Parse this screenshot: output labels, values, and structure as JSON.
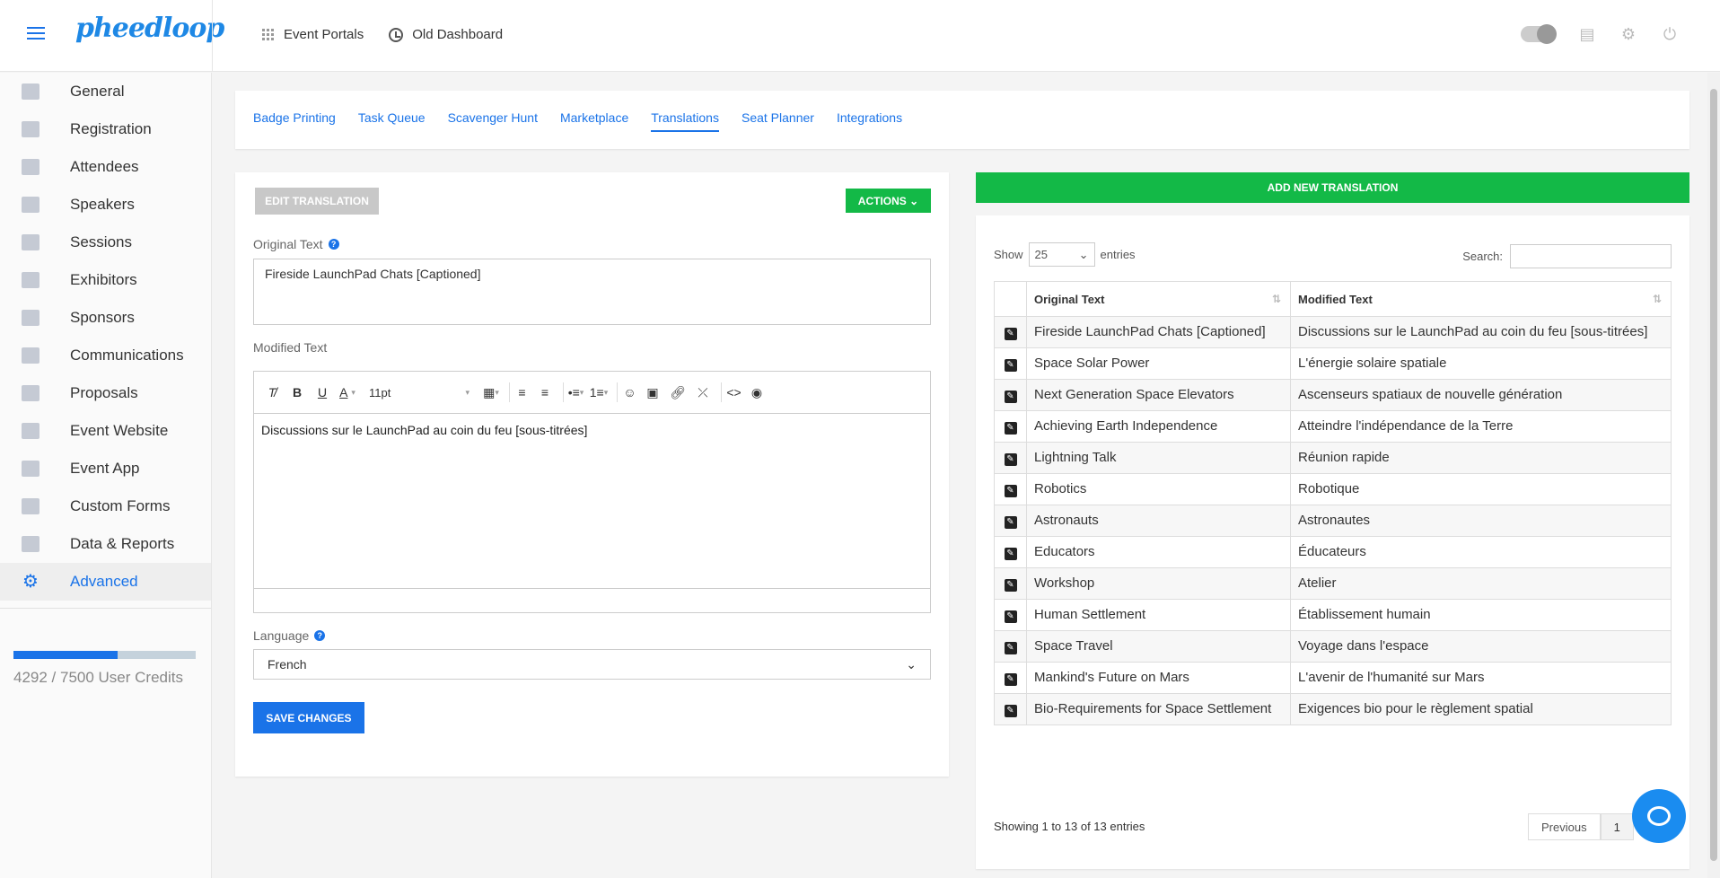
{
  "app": {
    "logo": "pheedloop"
  },
  "topnav": {
    "event_portals": "Event Portals",
    "old_dashboard": "Old Dashboard"
  },
  "sidebar": {
    "items": [
      {
        "label": "General",
        "icon": "pencil-icon"
      },
      {
        "label": "Registration",
        "icon": "users-icon"
      },
      {
        "label": "Attendees",
        "icon": "badge-icon"
      },
      {
        "label": "Speakers",
        "icon": "speaker-icon"
      },
      {
        "label": "Sessions",
        "icon": "upload-icon"
      },
      {
        "label": "Exhibitors",
        "icon": "store-icon"
      },
      {
        "label": "Sponsors",
        "icon": "briefcase-icon"
      },
      {
        "label": "Communications",
        "icon": "chat-icon"
      },
      {
        "label": "Proposals",
        "icon": "document-icon"
      },
      {
        "label": "Event Website",
        "icon": "browser-icon"
      },
      {
        "label": "Event App",
        "icon": "phone-icon"
      },
      {
        "label": "Custom Forms",
        "icon": "clipboard-icon"
      },
      {
        "label": "Data & Reports",
        "icon": "bar-chart-icon"
      },
      {
        "label": "Advanced",
        "icon": "gear-icon",
        "active": true
      }
    ],
    "credits": {
      "text": "4292 / 7500 User Credits",
      "used": 4292,
      "total": 7500
    }
  },
  "tabs": [
    "Badge Printing",
    "Task Queue",
    "Scavenger Hunt",
    "Marketplace",
    "Translations",
    "Seat Planner",
    "Integrations"
  ],
  "active_tab": "Translations",
  "edit": {
    "title_button": "EDIT TRANSLATION",
    "actions_button": "ACTIONS",
    "original_label": "Original Text",
    "original_value": "Fireside LaunchPad Chats [Captioned]",
    "modified_label": "Modified Text",
    "font_size": "11pt",
    "modified_value": "Discussions sur le LaunchPad au coin du feu [sous-titrées]",
    "language_label": "Language",
    "language_value": "French",
    "save_button": "SAVE CHANGES"
  },
  "list": {
    "add_button": "ADD NEW TRANSLATION",
    "show_label": "Show",
    "entries_value": "25",
    "entries_label": "entries",
    "search_label": "Search:",
    "columns": [
      "Original Text",
      "Modified Text"
    ],
    "rows": [
      [
        "Fireside LaunchPad Chats [Captioned]",
        "Discussions sur le LaunchPad au coin du feu [sous-titrées]"
      ],
      [
        "Space Solar Power",
        "L'énergie solaire spatiale"
      ],
      [
        "Next Generation Space Elevators",
        "Ascenseurs spatiaux de nouvelle génération"
      ],
      [
        "Achieving Earth Independence",
        "Atteindre l'indépendance de la Terre"
      ],
      [
        "Lightning Talk",
        "Réunion rapide"
      ],
      [
        "Robotics",
        "Robotique"
      ],
      [
        "Astronauts",
        "Astronautes"
      ],
      [
        "Educators",
        "Éducateurs"
      ],
      [
        "Workshop",
        "Atelier"
      ],
      [
        "Human Settlement",
        "Établissement humain"
      ],
      [
        "Space Travel",
        "Voyage dans l'espace"
      ],
      [
        "Mankind's Future on Mars",
        "L'avenir de l'humanité sur Mars"
      ],
      [
        "Bio-Requirements for Space Settlement",
        "Exigences bio pour le règlement spatial"
      ]
    ],
    "footer": "Showing 1 to 13 of 13 entries",
    "pager": {
      "previous": "Previous",
      "page": "1"
    }
  },
  "colors": {
    "accent": "#1a73e8",
    "green": "#13b947",
    "disabled": "#c8c8c8"
  }
}
